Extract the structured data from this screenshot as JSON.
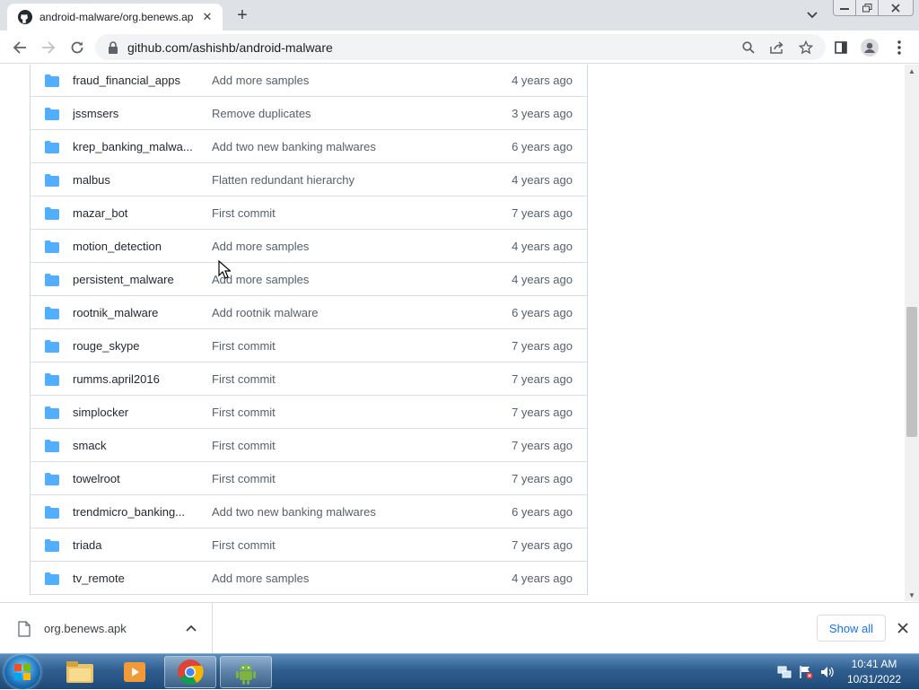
{
  "browser": {
    "tab_title": "android-malware/org.benews.ap",
    "tab_close": "✕",
    "new_tab": "+",
    "url": "github.com/ashishb/android-malware"
  },
  "files": [
    {
      "name": "fraud_financial_apps",
      "message": "Add more samples",
      "age": "4 years ago"
    },
    {
      "name": "jssmsers",
      "message": "Remove duplicates",
      "age": "3 years ago"
    },
    {
      "name": "krep_banking_malwa...",
      "message": "Add two new banking malwares",
      "age": "6 years ago"
    },
    {
      "name": "malbus",
      "message": "Flatten redundant hierarchy",
      "age": "4 years ago"
    },
    {
      "name": "mazar_bot",
      "message": "First commit",
      "age": "7 years ago"
    },
    {
      "name": "motion_detection",
      "message": "Add more samples",
      "age": "4 years ago"
    },
    {
      "name": "persistent_malware",
      "message": "Add more samples",
      "age": "4 years ago"
    },
    {
      "name": "rootnik_malware",
      "message": "Add rootnik malware",
      "age": "6 years ago"
    },
    {
      "name": "rouge_skype",
      "message": "First commit",
      "age": "7 years ago"
    },
    {
      "name": "rumms.april2016",
      "message": "First commit",
      "age": "7 years ago"
    },
    {
      "name": "simplocker",
      "message": "First commit",
      "age": "7 years ago"
    },
    {
      "name": "smack",
      "message": "First commit",
      "age": "7 years ago"
    },
    {
      "name": "towelroot",
      "message": "First commit",
      "age": "7 years ago"
    },
    {
      "name": "trendmicro_banking...",
      "message": "Add two new banking malwares",
      "age": "6 years ago"
    },
    {
      "name": "triada",
      "message": "First commit",
      "age": "7 years ago"
    },
    {
      "name": "tv_remote",
      "message": "Add more samples",
      "age": "4 years ago"
    }
  ],
  "download_shelf": {
    "file_name": "org.benews.apk",
    "show_all": "Show all"
  },
  "taskbar": {
    "time": "10:41 AM",
    "date": "10/31/2022"
  },
  "colors": {
    "folder": "#54aeff",
    "link_blue": "#1a73e8",
    "border": "#d0d7de"
  },
  "icons": [
    "github-icon",
    "folder-icon",
    "lock-icon",
    "search-icon",
    "share-icon",
    "star-icon",
    "sidepanel-icon",
    "profile-icon",
    "menu-icon"
  ]
}
